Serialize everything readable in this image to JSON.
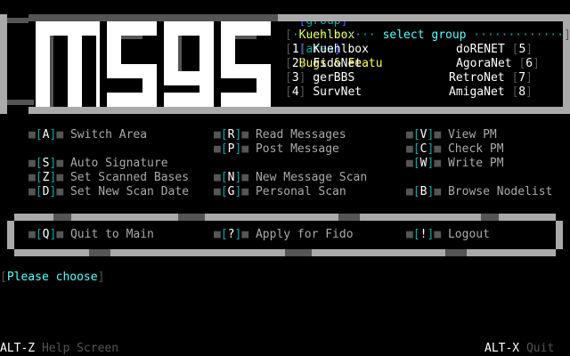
{
  "header": {
    "group_tag": "group",
    "group_value": "Kuehlbox",
    "area_tag": "area",
    "area_value": "Bugs & Featu"
  },
  "logo": {
    "text": "msgs"
  },
  "select_group": {
    "title": "select group",
    "left": [
      {
        "key": "1",
        "label": "Kuehlbox"
      },
      {
        "key": "2",
        "label": "FidoNet"
      },
      {
        "key": "3",
        "label": "gerBBS"
      },
      {
        "key": "4",
        "label": "SurvNet"
      }
    ],
    "right": [
      {
        "key": "5",
        "label": "doRENET"
      },
      {
        "key": "6",
        "label": "AgoraNet"
      },
      {
        "key": "7",
        "label": "RetroNet"
      },
      {
        "key": "8",
        "label": "AmigaNet"
      }
    ]
  },
  "menu": {
    "col1": [
      {
        "key": "A",
        "label": "Switch Area",
        "row": 0
      },
      {
        "key": "S",
        "label": "Auto Signature",
        "row": 2
      },
      {
        "key": "Z",
        "label": "Set Scanned Bases",
        "row": 3
      },
      {
        "key": "D",
        "label": "Set New Scan Date",
        "row": 4
      }
    ],
    "col2": [
      {
        "key": "R",
        "label": "Read Messages",
        "row": 0
      },
      {
        "key": "P",
        "label": "Post Message",
        "row": 1
      },
      {
        "key": "N",
        "label": "New Message Scan",
        "row": 3
      },
      {
        "key": "G",
        "label": "Personal Scan",
        "row": 4
      }
    ],
    "col3": [
      {
        "key": "V",
        "label": "View PM",
        "row": 0
      },
      {
        "key": "C",
        "label": "Check PM",
        "row": 1
      },
      {
        "key": "W",
        "label": "Write PM",
        "row": 2
      },
      {
        "key": "B",
        "label": "Browse Nodelist",
        "row": 4
      }
    ]
  },
  "bottom_menu": [
    {
      "key": "Q",
      "label": "Quit to Main"
    },
    {
      "key": "?",
      "label": "Apply for Fido"
    },
    {
      "key": "!",
      "label": "Logout"
    }
  ],
  "prompt": "Please choose",
  "footer": {
    "help_key": "ALT-Z",
    "help_label": "Help Screen",
    "quit_key": "ALT-X",
    "quit_label": "Quit"
  }
}
